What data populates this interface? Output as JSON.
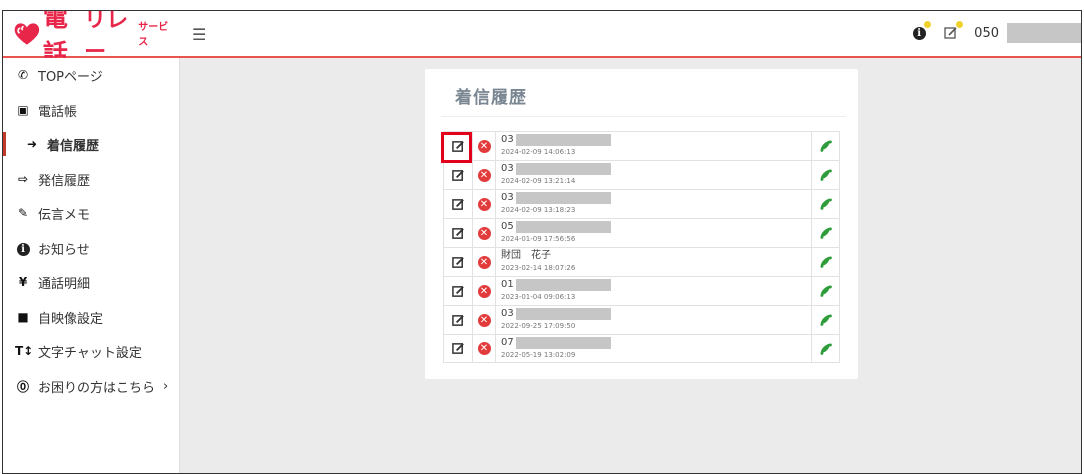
{
  "app": {
    "logo_main": "電話",
    "logo_sub": "リレー",
    "logo_small": "サービス"
  },
  "header": {
    "menu_icon": "hamburger-icon",
    "phone_prefix": "050"
  },
  "sidebar": {
    "items": [
      {
        "label": "TOPページ",
        "icon": "phone-icon",
        "glyph": "✆"
      },
      {
        "label": "電話帳",
        "icon": "address-book-icon",
        "glyph": "▣"
      },
      {
        "label": "着信履歴",
        "icon": "sign-in-icon",
        "glyph": "➜",
        "active": true
      },
      {
        "label": "発信履歴",
        "icon": "sign-out-icon",
        "glyph": "⇨"
      },
      {
        "label": "伝言メモ",
        "icon": "edit-icon",
        "glyph": "✎"
      },
      {
        "label": "お知らせ",
        "icon": "info-icon",
        "glyph": "i"
      },
      {
        "label": "通話明細",
        "icon": "yen-icon",
        "glyph": "¥"
      },
      {
        "label": "自映像設定",
        "icon": "video-camera-icon",
        "glyph": "■"
      },
      {
        "label": "文字チャット設定",
        "icon": "text-height-icon",
        "glyph": "T↕"
      },
      {
        "label": "お困りの方はこちら",
        "icon": "question-circle-icon",
        "glyph": "?",
        "chevron": "›"
      }
    ]
  },
  "main": {
    "card_title": "着信履歴",
    "calls": [
      {
        "number": "03",
        "timestamp": "2024-02-09 14:06:13"
      },
      {
        "number": "03",
        "timestamp": "2024-02-09 13:21:14"
      },
      {
        "number": "03",
        "timestamp": "2024-02-09 13:18:23"
      },
      {
        "number": "05",
        "timestamp": "2024-01-09 17:56:56"
      },
      {
        "number": "財団　花子",
        "timestamp": "2023-02-14 18:07:26",
        "named": true
      },
      {
        "number": "01",
        "timestamp": "2023-01-04 09:06:13"
      },
      {
        "number": "03",
        "timestamp": "2022-09-25 17:09:50"
      },
      {
        "number": "07",
        "timestamp": "2022-05-19 13:02:09"
      }
    ]
  },
  "colors": {
    "brand": "#e8264a",
    "header_border": "#e8544e",
    "delete": "#e23b3b",
    "call": "#2e9c3a",
    "highlight": "#e3001b"
  }
}
